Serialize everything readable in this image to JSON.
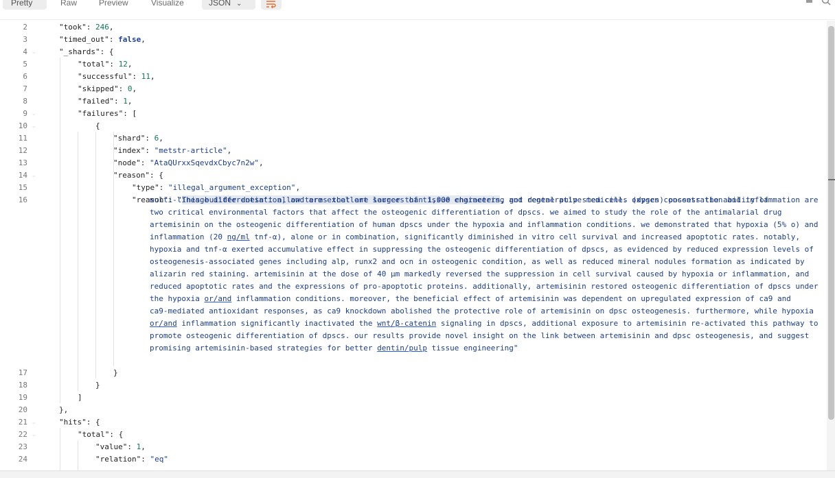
{
  "toolbar": {
    "tabs": [
      "Pretty",
      "Raw",
      "Preview",
      "Visualize"
    ],
    "format": "JSON"
  },
  "editor": {
    "line_numbers": [
      "2",
      "3",
      "4",
      "5",
      "6",
      "7",
      "8",
      "9",
      "10",
      "11",
      "12",
      "13",
      "14",
      "15",
      "16",
      "17",
      "18",
      "19",
      "20",
      "21",
      "22",
      "23",
      "24"
    ],
    "lines": {
      "took_key": "\"took\"",
      "took_val": "246",
      "timed_out_key": "\"timed_out\"",
      "timed_out_val": "false",
      "shards_key": "\"_shards\"",
      "total_key": "\"total\"",
      "total_val": "12",
      "successful_key": "\"successful\"",
      "successful_val": "11",
      "skipped_key": "\"skipped\"",
      "skipped_val": "0",
      "failed_key": "\"failed\"",
      "failed_val": "1",
      "failures_key": "\"failures\"",
      "shard_key": "\"shard\"",
      "shard_val": "6",
      "index_key": "\"index\"",
      "index_val": "\"metstr-article\"",
      "node_key": "\"node\"",
      "node_val": "\"AtaQUrxxSqevdxCbyc7n2w\"",
      "reason_key": "\"reason\"",
      "type_key": "\"type\"",
      "type_val": "\"illegal_argument_exception\"",
      "reason2_key": "\"reason\"",
      "hits_key": "\"hits\"",
      "hits_total_key": "\"total\"",
      "value_key": "\"value\"",
      "value_val": "1",
      "relation_key": "\"relation\"",
      "relation_val": "\"eq\""
    },
    "reason_text": {
      "open_quote": "\"",
      "highlighted": "This builder doesn't allow terms that are larger than 1,000 characters",
      "l1_rest": ", got dental pulp stem cells (dpscs) possess the ability of",
      "l2": "multi-lineage differentiation, and are excellent sources of tissue engineering and regenerative medicine. oxygen concentration and inflammation are",
      "l3": "two critical environmental factors that affect the osteogenic differentiation of dpscs. we aimed to study the role of the antimalarial drug",
      "l4": "artemisinin on the osteogenic differentiation of human dpscs under the hypoxia and inflammation conditions. we demonstrated that hypoxia (5% o) and",
      "l5a": "inflammation (20 ",
      "l5u": "ng/ml",
      "l5b": " tnf-α), alone or in combination, significantly diminished in vitro cell survival and increased apoptotic rates. notably,",
      "l6": "hypoxia and tnf-α exerted accumulative effect in suppressing the osteogenic differentiation of dpscs, as evidenced by reduced expression levels of",
      "l7": "osteogenesis-associated genes including alp, runx2 and ocn in osteogenic condition, as well as reduced mineral nodules formation as indicated by",
      "l8": "alizarin red staining. artemisinin at the dose of 40 μm markedly reversed the suppression in cell survival caused by hypoxia or inflammation, and",
      "l9": "reduced apoptotic rates and the expressions of pro-apoptotic proteins. additionally, artemisinin restored osteogenic differentiation of dpscs under",
      "l10a": "the hypoxia ",
      "l10u": "or/and",
      "l10b": " inflammation conditions. moreover, the beneficial effect of artemisinin was dependent on upregulated expression of ca9 and",
      "l11": "ca9-mediated antioxidant responses, as ca9 knockdown abolished the protective role of artemisinin on dpsc osteogenesis. furthermore, while hypoxia",
      "l12a": "",
      "l12u": "or/and",
      "l12b": " inflammation significantly inactivated the ",
      "l12u2": "wnt/β-catenin",
      "l12c": " signaling in dpscs, additional exposure to artemisinin re-activated this pathway to",
      "l13": "promote osteogenic differentiation of dpscs. our results provide novel insight on the link between artemisinin and dpsc osteogenesis, and suggest",
      "l14a": "promising artemisinin-based strategies for better ",
      "l14u": "dentin/pulp",
      "l14b": " tissue engineering\""
    }
  }
}
